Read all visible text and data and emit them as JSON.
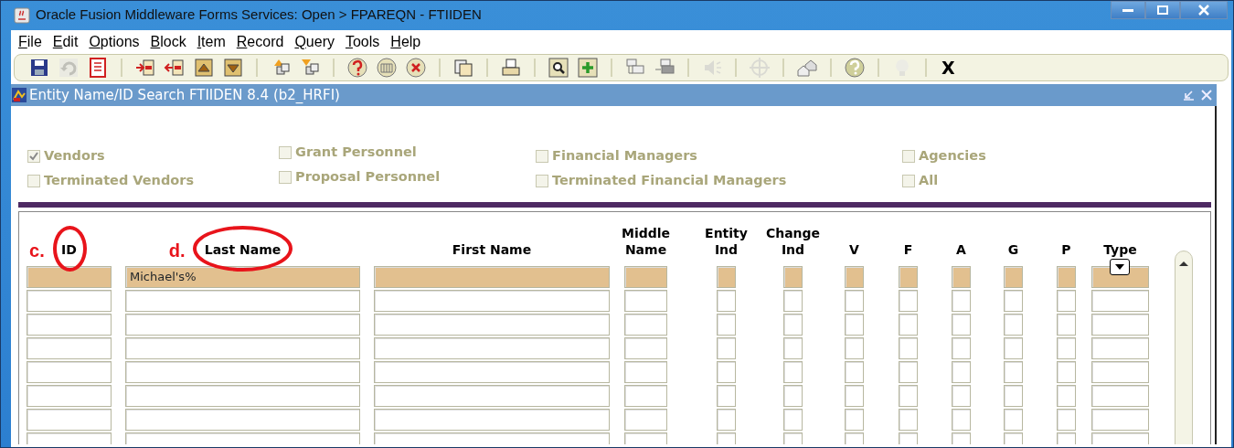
{
  "window": {
    "title": "Oracle Fusion Middleware Forms Services:  Open > FPAREQN - FTIIDEN"
  },
  "menu": [
    {
      "label": "File"
    },
    {
      "label": "Edit"
    },
    {
      "label": "Options"
    },
    {
      "label": "Block"
    },
    {
      "label": "Item"
    },
    {
      "label": "Record"
    },
    {
      "label": "Query"
    },
    {
      "label": "Tools"
    },
    {
      "label": "Help"
    }
  ],
  "toolbar": {
    "groups": [
      [
        {
          "disabled": false
        },
        {
          "disabled": true
        },
        {
          "disabled": false
        }
      ],
      [
        {
          "disabled": false
        },
        {
          "disabled": false
        },
        {
          "disabled": false
        },
        {
          "disabled": false
        }
      ],
      [
        {
          "disabled": false
        },
        {
          "disabled": false
        }
      ],
      [
        {
          "disabled": false
        },
        {
          "disabled": false
        },
        {
          "disabled": false
        }
      ],
      [
        {
          "disabled": false
        }
      ],
      [
        {
          "disabled": false
        }
      ],
      [
        {
          "disabled": false
        },
        {
          "disabled": false
        }
      ],
      [
        {
          "disabled": false
        },
        {
          "disabled": false
        }
      ],
      [
        {
          "disabled": true
        }
      ],
      [
        {
          "disabled": true
        }
      ],
      [
        {
          "disabled": false
        }
      ],
      [
        {
          "disabled": false
        }
      ],
      [
        {
          "disabled": true
        }
      ]
    ],
    "exit_label": "X"
  },
  "form": {
    "title": "Entity Name/ID Search  FTIIDEN  8.4  (b2_HRFI)"
  },
  "filters": [
    [
      {
        "label": "Vendors",
        "checked": true
      },
      {
        "label": "Terminated Vendors",
        "checked": false
      }
    ],
    [
      {
        "label": "Grant Personnel",
        "checked": false
      },
      {
        "label": "Proposal Personnel",
        "checked": false
      }
    ],
    [
      {
        "label": "Financial Managers",
        "checked": false
      },
      {
        "label": "Terminated Financial Managers",
        "checked": false
      }
    ],
    [
      {
        "label": "Agencies",
        "checked": false
      },
      {
        "label": "All",
        "checked": false
      }
    ]
  ],
  "table": {
    "columns": [
      {
        "lines": [
          "ID"
        ],
        "annotation": "c."
      },
      {
        "lines": [
          "Last Name"
        ],
        "annotation": "d."
      },
      {
        "lines": [
          "First Name"
        ]
      },
      {
        "lines": [
          "Middle",
          "Name"
        ]
      },
      {
        "lines": [
          "Entity",
          "Ind"
        ]
      },
      {
        "lines": [
          "Change",
          "Ind"
        ]
      },
      {
        "lines": [
          "V"
        ]
      },
      {
        "lines": [
          "F"
        ]
      },
      {
        "lines": [
          "A"
        ]
      },
      {
        "lines": [
          "G"
        ]
      },
      {
        "lines": [
          "P"
        ]
      },
      {
        "lines": [
          "Type"
        ],
        "dropdown": true
      }
    ],
    "rows": [
      {
        "current": true,
        "cells": {
          "1": "Michael's%"
        }
      },
      {
        "current": false
      },
      {
        "current": false
      },
      {
        "current": false
      },
      {
        "current": false
      },
      {
        "current": false
      },
      {
        "current": false
      },
      {
        "current": false
      }
    ]
  }
}
